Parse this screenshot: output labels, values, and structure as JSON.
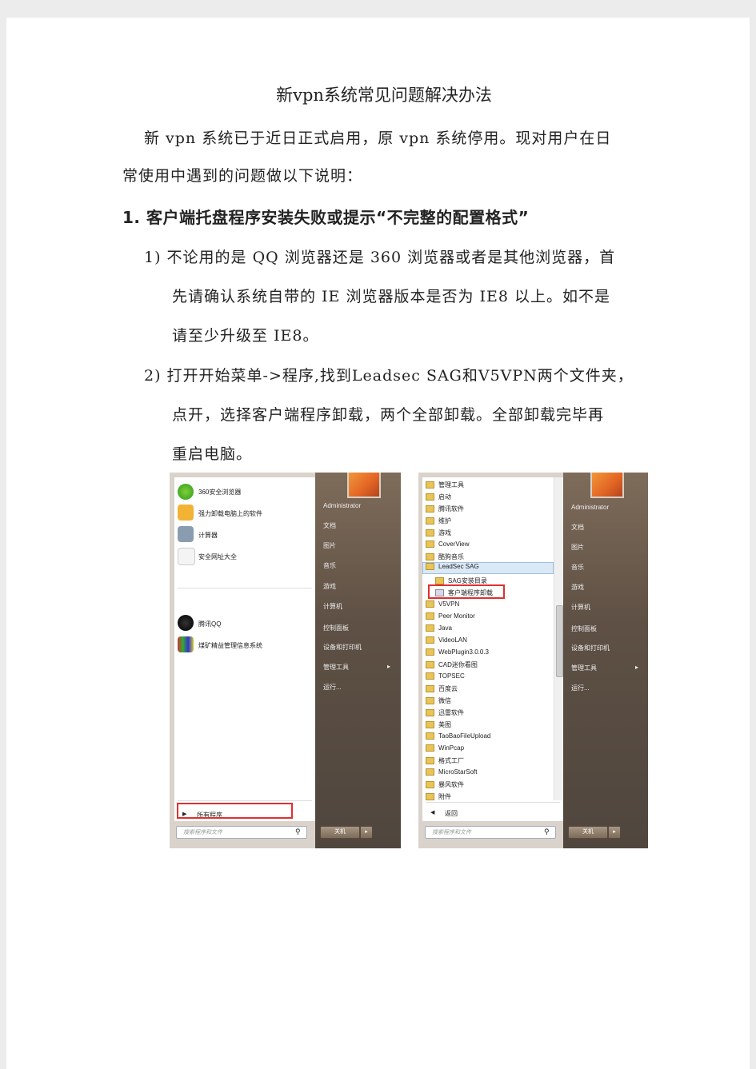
{
  "title": "新vpn系统常见问题解决办法",
  "intro_lines": [
    "新 vpn 系统已于近日正式启用，原 vpn 系统停用。现对用户在日",
    "常使用中遇到的问题做以下说明："
  ],
  "section1": {
    "heading": "1. 客户端托盘程序安装失败或提示“不完整的配置格式”",
    "step1_lines": [
      "1) 不论用的是 QQ 浏览器还是 360 浏览器或者是其他浏览器，首",
      "先请确认系统自带的 IE 浏览器版本是否为 IE8 以上。如不是",
      "请至少升级至 IE8。"
    ],
    "step2_lines": [
      "2) 打开开始菜单->程序,找到Leadsec SAG和V5VPN两个文件夹，",
      "点开，选择客户端程序卸载，两个全部卸载。全部卸载完毕再",
      "重启电脑。"
    ]
  },
  "screenshot1": {
    "programs": [
      "360安全浏览器",
      "强力卸载电脑上的软件",
      "计算器",
      "安全网址大全",
      "腾讯QQ",
      "煤矿精益管理信息系统"
    ],
    "all_programs": "所有程序",
    "right_items": [
      "Administrator",
      "文档",
      "图片",
      "音乐",
      "游戏",
      "计算机",
      "控制面板",
      "设备和打印机",
      "管理工具",
      "运行..."
    ],
    "search_placeholder": "搜索程序和文件",
    "shutdown": "关机"
  },
  "screenshot2": {
    "folders": [
      "管理工具",
      "启动",
      "腾讯软件",
      "维护",
      "游戏",
      "CoverView",
      "酷狗音乐",
      "LeadSec SAG"
    ],
    "sub_items": [
      "SAG安装目录",
      "客户端程序卸载"
    ],
    "folders_after": [
      "V5VPN",
      "Peer Monitor",
      "Java",
      "VideoLAN",
      "WebPlugin3.0.0.3",
      "CAD迷你看图",
      "TOPSEC",
      "百度云",
      "微信",
      "迅雷软件",
      "美图",
      "TaoBaoFileUpload",
      "WinPcap",
      "格式工厂",
      "MicroStarSoft",
      "暴风软件",
      "附件"
    ],
    "back": "返回",
    "right_items": [
      "Administrator",
      "文档",
      "图片",
      "音乐",
      "游戏",
      "计算机",
      "控制面板",
      "设备和打印机",
      "管理工具",
      "运行..."
    ],
    "search_placeholder": "搜索程序和文件",
    "shutdown": "关机"
  },
  "colors": {
    "highlight": "#e03030",
    "menu_dark": "#5e5044"
  }
}
